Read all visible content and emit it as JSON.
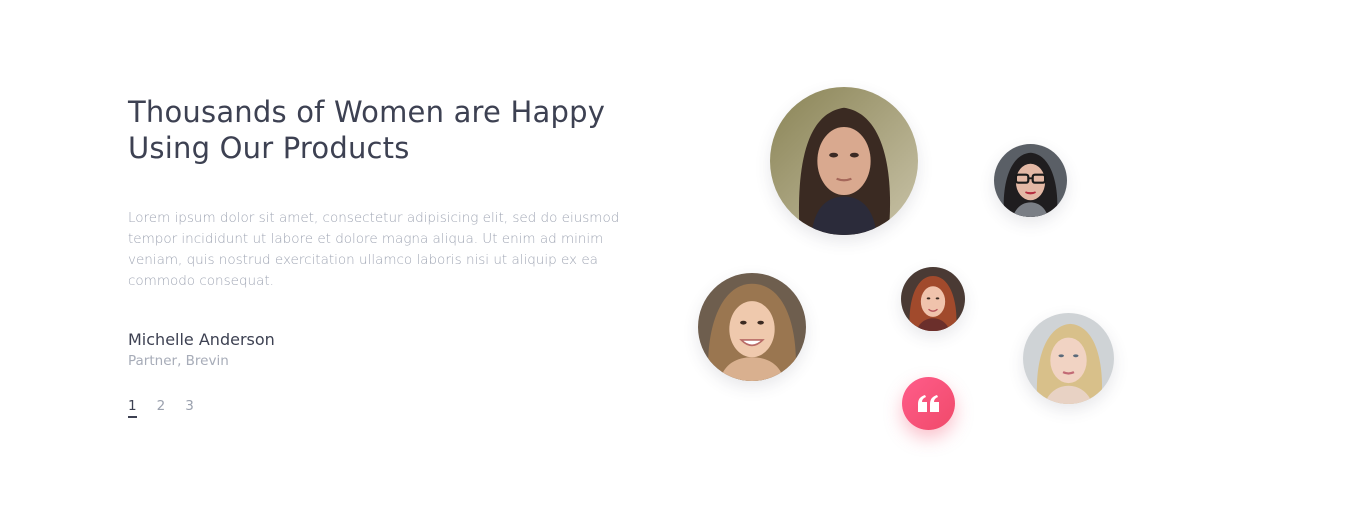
{
  "testimonial": {
    "headline_line1": "Thousands of Women are Happy",
    "headline_line2": "Using Our Products",
    "body": "Lorem ipsum dolor sit amet, consectetur adipisicing elit, sed do eiusmod tempor incididunt ut labore et dolore magna aliqua. Ut enim ad minim veniam, quis nostrud exercitation ullamco laboris nisi ut aliquip ex ea commodo consequat.",
    "author_name": "Michelle Anderson",
    "author_role": "Partner, Brevin"
  },
  "pager": {
    "pages": [
      "1",
      "2",
      "3"
    ],
    "active": "1"
  },
  "avatars": {
    "count": 6
  },
  "quote_button": {
    "icon": "quote-icon"
  },
  "colors": {
    "heading": "#3d4152",
    "body_text": "#a0a6b4",
    "accent_start": "#ff5c8a",
    "accent_end": "#f04a6a"
  }
}
